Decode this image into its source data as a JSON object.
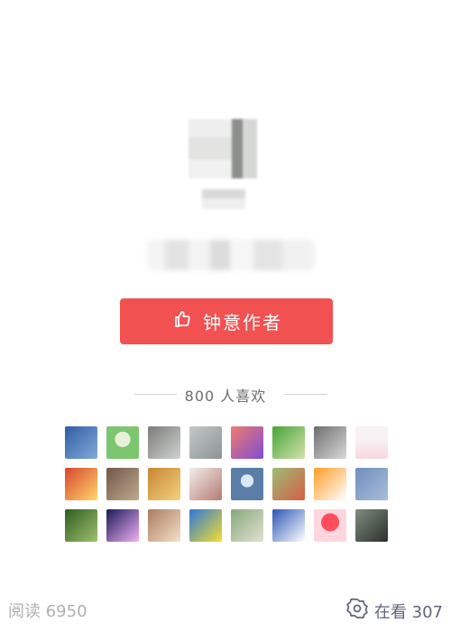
{
  "profile": {
    "avatar_state": "pixelated",
    "name_state": "blurred",
    "signature_state": "blurred"
  },
  "actions": {
    "like_author_label": "钟意作者"
  },
  "likes": {
    "count_label": "800 人喜欢",
    "avatars": [
      {
        "name": "avatar-1",
        "colors": [
          "#2f5ea4",
          "#83a9d8"
        ]
      },
      {
        "name": "avatar-2",
        "colors": [
          "#7cc66f",
          "#e9f0d8"
        ]
      },
      {
        "name": "avatar-3",
        "colors": [
          "#7c7c78",
          "#d0d3d2"
        ]
      },
      {
        "name": "avatar-4",
        "colors": [
          "#c4c8c8",
          "#8d9493"
        ]
      },
      {
        "name": "avatar-5",
        "colors": [
          "#ef7b6d",
          "#7e4ed7"
        ]
      },
      {
        "name": "avatar-6",
        "colors": [
          "#46a636",
          "#d4e1ad"
        ]
      },
      {
        "name": "avatar-7",
        "colors": [
          "#6e6e6e",
          "#d9d9d9"
        ]
      },
      {
        "name": "avatar-8",
        "colors": [
          "#f8d7e0",
          "#f7f2f3"
        ]
      },
      {
        "name": "avatar-9",
        "colors": [
          "#d7462f",
          "#ffd66a"
        ]
      },
      {
        "name": "avatar-10",
        "colors": [
          "#6f5848",
          "#bfaa8f"
        ]
      },
      {
        "name": "avatar-11",
        "colors": [
          "#c78532",
          "#f3d27c"
        ]
      },
      {
        "name": "avatar-12",
        "colors": [
          "#f2efe9",
          "#b67b73"
        ]
      },
      {
        "name": "avatar-13",
        "colors": [
          "#5a7ea7",
          "#d9e8f7"
        ]
      },
      {
        "name": "avatar-14",
        "colors": [
          "#9bbd74",
          "#d55e46"
        ]
      },
      {
        "name": "avatar-15",
        "colors": [
          "#ff9d25",
          "#ffffff"
        ]
      },
      {
        "name": "avatar-16",
        "colors": [
          "#6f8fbe",
          "#a9bdd9"
        ]
      },
      {
        "name": "avatar-17",
        "colors": [
          "#2e5d1f",
          "#9ec06d"
        ]
      },
      {
        "name": "avatar-18",
        "colors": [
          "#1a1a58",
          "#f2b0f5"
        ]
      },
      {
        "name": "avatar-19",
        "colors": [
          "#ab7c60",
          "#f4e1c8"
        ]
      },
      {
        "name": "avatar-20",
        "colors": [
          "#2d77d8",
          "#f5de2f"
        ]
      },
      {
        "name": "avatar-21",
        "colors": [
          "#87a87d",
          "#e1e1d1"
        ]
      },
      {
        "name": "avatar-22",
        "colors": [
          "#2c55b5",
          "#ffffff"
        ]
      },
      {
        "name": "avatar-23",
        "colors": [
          "#ff4d5d",
          "#ffd6dd"
        ]
      },
      {
        "name": "avatar-24",
        "colors": [
          "#7e8e7e",
          "#2c2f2c"
        ]
      }
    ]
  },
  "footer": {
    "read_label": "阅读 6950",
    "watching_label": "在看 307"
  },
  "colors": {
    "button_red": "#f25152",
    "muted_text": "#b0b0b0",
    "icon_slate": "#5e6679"
  }
}
